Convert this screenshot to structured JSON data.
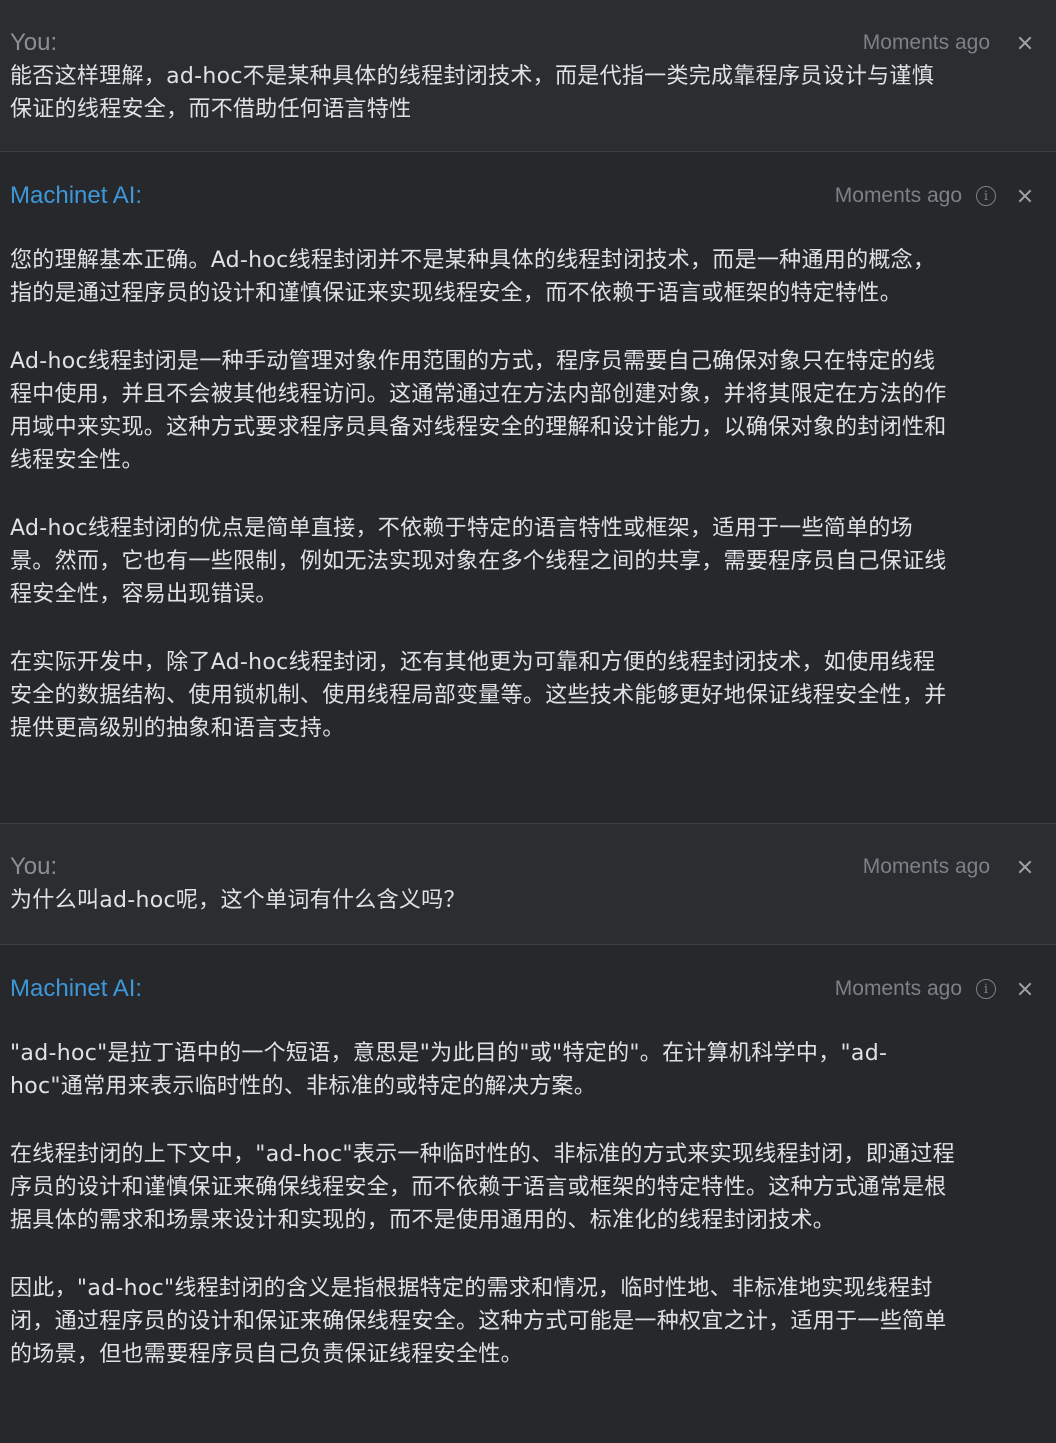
{
  "messages": [
    {
      "role": "user",
      "author": "You:",
      "time": "Moments ago",
      "paragraphs": [
        "能否这样理解，ad-hoc不是某种具体的线程封闭技术，而是代指一类完成靠程序员设计与谨慎保证的线程安全，而不借助任何语言特性"
      ]
    },
    {
      "role": "ai",
      "author": "Machinet AI:",
      "time": "Moments ago",
      "paragraphs": [
        "您的理解基本正确。Ad-hoc线程封闭并不是某种具体的线程封闭技术，而是一种通用的概念，指的是通过程序员的设计和谨慎保证来实现线程安全，而不依赖于语言或框架的特定特性。",
        "Ad-hoc线程封闭是一种手动管理对象作用范围的方式，程序员需要自己确保对象只在特定的线程中使用，并且不会被其他线程访问。这通常通过在方法内部创建对象，并将其限定在方法的作用域中来实现。这种方式要求程序员具备对线程安全的理解和设计能力，以确保对象的封闭性和线程安全性。",
        "Ad-hoc线程封闭的优点是简单直接，不依赖于特定的语言特性或框架，适用于一些简单的场景。然而，它也有一些限制，例如无法实现对象在多个线程之间的共享，需要程序员自己保证线程安全性，容易出现错误。",
        "在实际开发中，除了Ad-hoc线程封闭，还有其他更为可靠和方便的线程封闭技术，如使用线程安全的数据结构、使用锁机制、使用线程局部变量等。这些技术能够更好地保证线程安全性，并提供更高级别的抽象和语言支持。"
      ]
    },
    {
      "role": "user",
      "author": "You:",
      "time": "Moments ago",
      "paragraphs": [
        "为什么叫ad-hoc呢，这个单词有什么含义吗？"
      ]
    },
    {
      "role": "ai",
      "author": "Machinet AI:",
      "time": "Moments ago",
      "paragraphs": [
        "\"ad-hoc\"是拉丁语中的一个短语，意思是\"为此目的\"或\"特定的\"。在计算机科学中，\"ad-hoc\"通常用来表示临时性的、非标准的或特定的解决方案。",
        "在线程封闭的上下文中，\"ad-hoc\"表示一种临时性的、非标准的方式来实现线程封闭，即通过程序员的设计和谨慎保证来确保线程安全，而不依赖于语言或框架的特定特性。这种方式通常是根据具体的需求和场景来设计和实现的，而不是使用通用的、标准化的线程封闭技术。",
        "因此，\"ad-hoc\"线程封闭的含义是指根据特定的需求和情况，临时性地、非标准地实现线程封闭，通过程序员的设计和保证来确保线程安全。这种方式可能是一种权宜之计，适用于一些简单的场景，但也需要程序员自己负责保证线程安全性。"
      ]
    }
  ],
  "icons": {
    "info": "info-icon",
    "close": "close-icon"
  },
  "colors": {
    "background": "#2b2d30",
    "ai_author": "#3d97d8",
    "user_author": "#8c8f94",
    "text": "#dfe1e5",
    "timestamp": "#7d8086"
  }
}
